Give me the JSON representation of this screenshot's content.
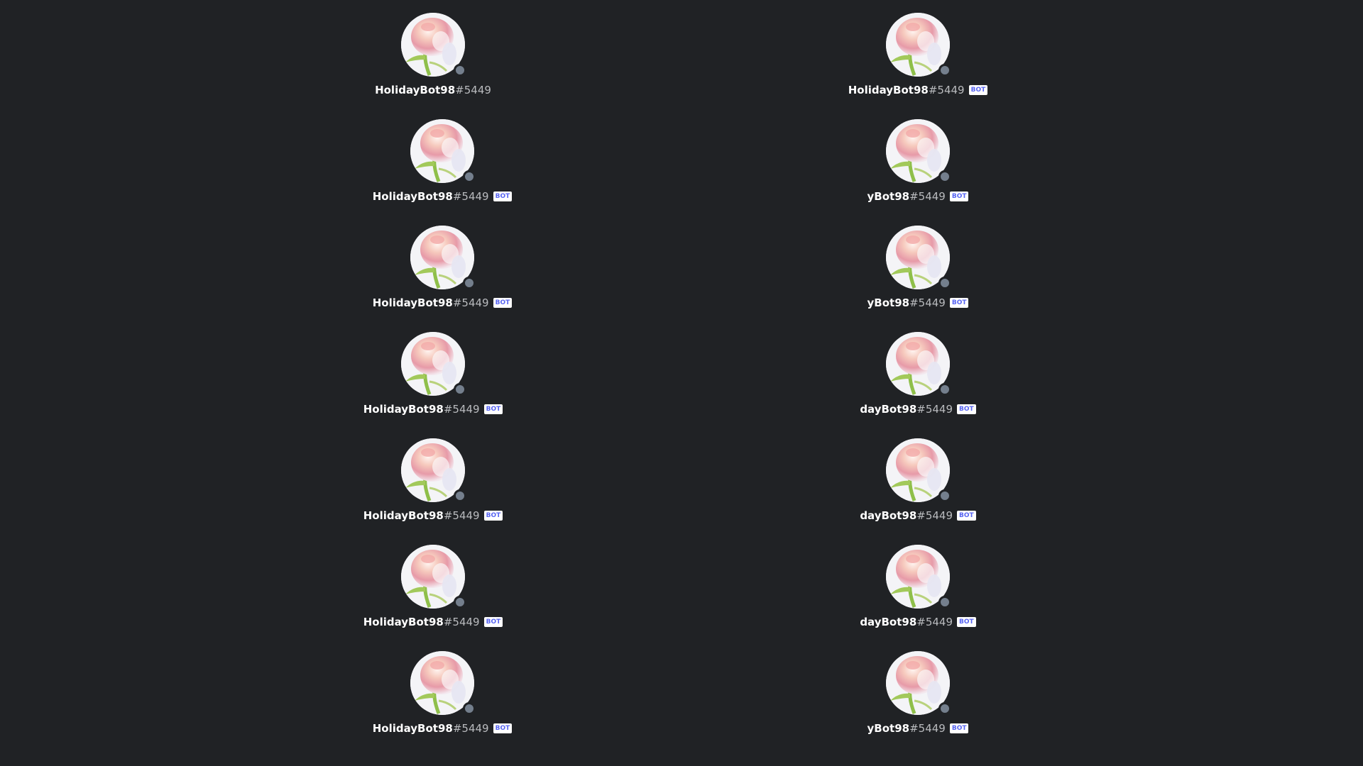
{
  "colors": {
    "background": "#202225",
    "username": "#ffffff",
    "discriminator": "#b9bbbe",
    "bot_tag_bg": "#ffffff",
    "bot_tag_text": "#5865f2",
    "status_offline": "#747f8d"
  },
  "avatar_icon": "flower-avatar-icon",
  "bot_tag_label": "BOT",
  "profiles": [
    {
      "username": "HolidayBot98",
      "discriminator": "#5449",
      "bot": false
    },
    {
      "username": "HolidayBot98",
      "discriminator": "#5449",
      "bot": true
    },
    {
      "username": "HolidayBot98",
      "discriminator": "#5449",
      "bot": true
    },
    {
      "username": "yBot98",
      "discriminator": "#5449",
      "bot": true
    },
    {
      "username": "HolidayBot98",
      "discriminator": "#5449",
      "bot": true
    },
    {
      "username": "yBot98",
      "discriminator": "#5449",
      "bot": true
    },
    {
      "username": "HolidayBot98",
      "discriminator": "#5449",
      "bot": true
    },
    {
      "username": "dayBot98",
      "discriminator": "#5449",
      "bot": true
    },
    {
      "username": "HolidayBot98",
      "discriminator": "#5449",
      "bot": true
    },
    {
      "username": "dayBot98",
      "discriminator": "#5449",
      "bot": true
    },
    {
      "username": "HolidayBot98",
      "discriminator": "#5449",
      "bot": true
    },
    {
      "username": "dayBot98",
      "discriminator": "#5449",
      "bot": true
    },
    {
      "username": "HolidayBot98",
      "discriminator": "#5449",
      "bot": true
    },
    {
      "username": "yBot98",
      "discriminator": "#5449",
      "bot": true
    }
  ]
}
